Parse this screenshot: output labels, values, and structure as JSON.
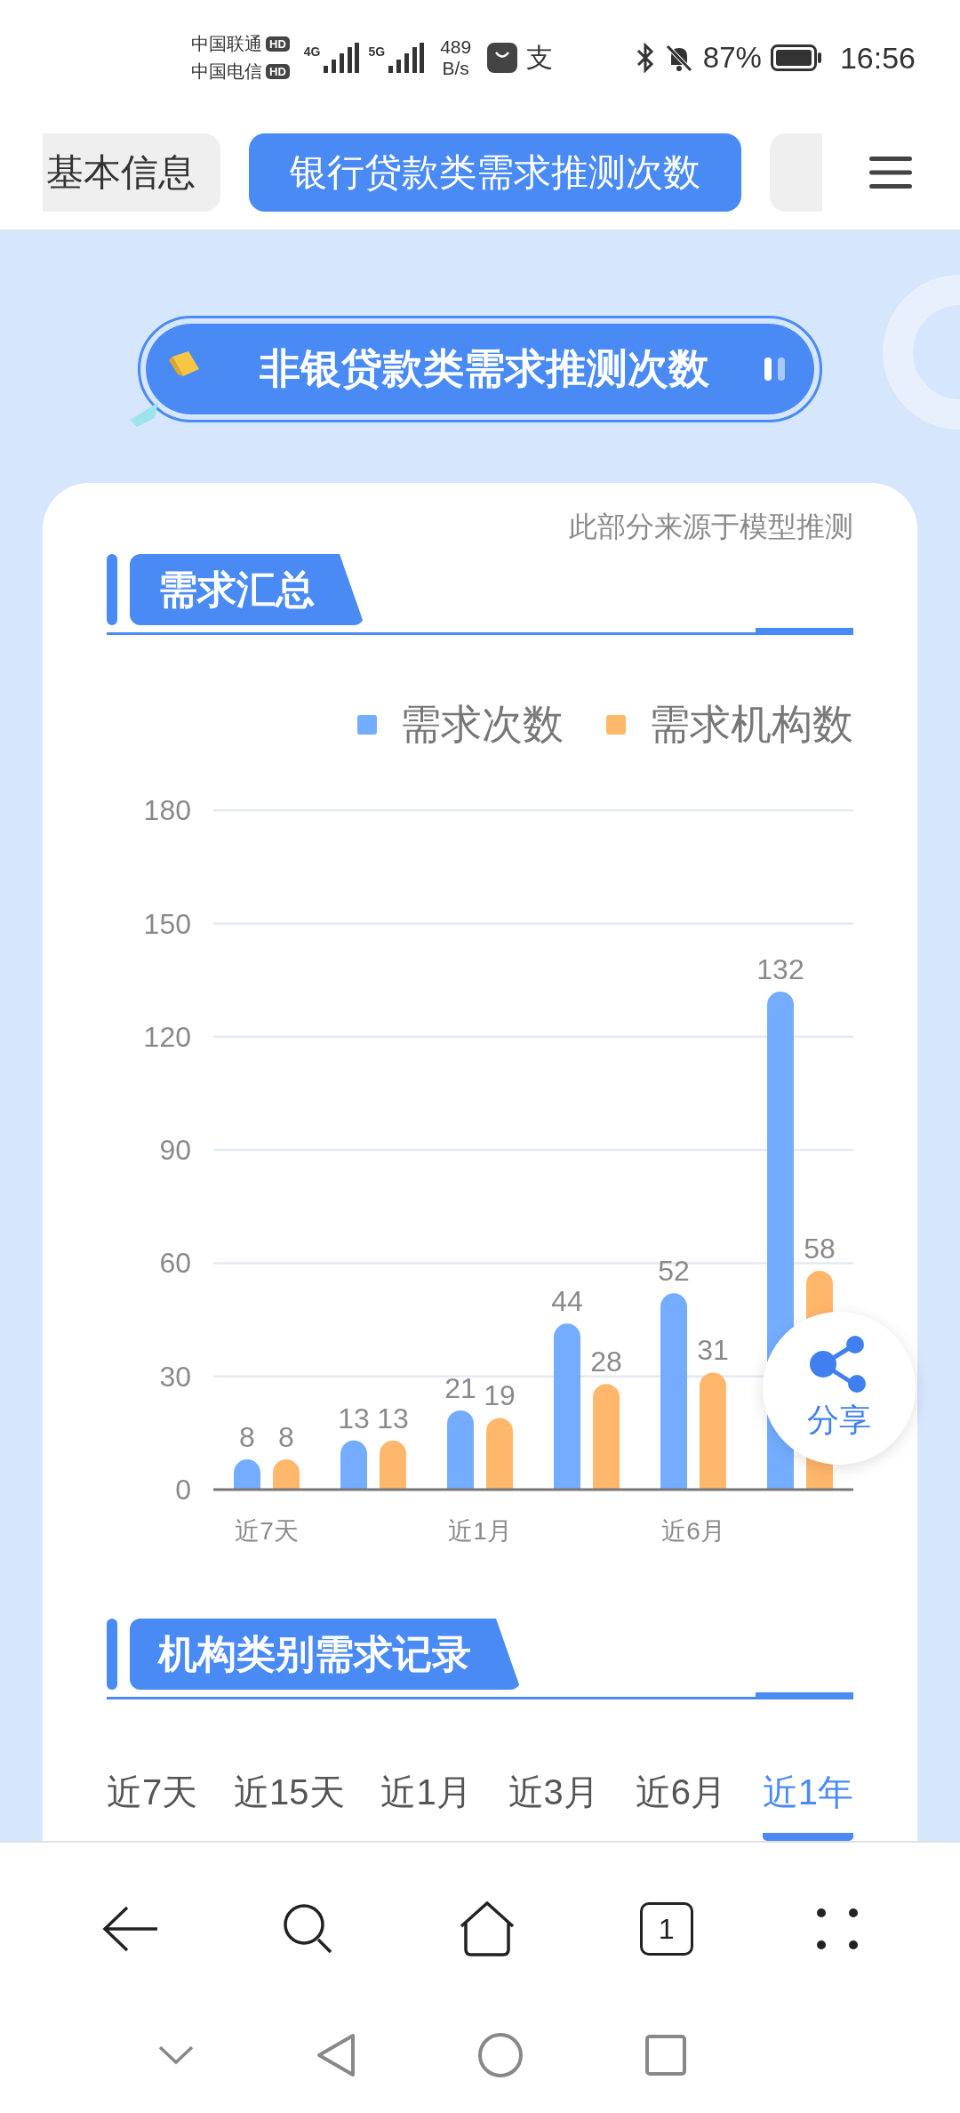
{
  "status_bar": {
    "carriers": [
      {
        "name": "中国联通",
        "badge": "HD"
      },
      {
        "name": "中国电信",
        "badge": "HD"
      }
    ],
    "networks": [
      "4G",
      "5G"
    ],
    "speed": {
      "value": "489",
      "unit": "B/s"
    },
    "app_glyph": "支",
    "battery": "87%",
    "time": "16:56"
  },
  "tabs": [
    {
      "label": "基本信息",
      "selected": false
    },
    {
      "label": "银行贷款类需求推测次数",
      "selected": true
    }
  ],
  "banner": {
    "title": "非银贷款类需求推测次数"
  },
  "card": {
    "note": "此部分来源于模型推测",
    "summary": {
      "title": "需求汇总",
      "chart_data": {
        "type": "bar",
        "categories": [
          "近7天",
          null,
          "近1月",
          null,
          "近6月",
          null
        ],
        "ylim": [
          0,
          180
        ],
        "yticks": [
          0,
          30,
          60,
          90,
          120,
          150,
          180
        ],
        "data_labels": true,
        "grid": true,
        "series": [
          {
            "name": "需求次数",
            "color": "#74adff",
            "values": [
              8,
              13,
              21,
              44,
              52,
              132
            ]
          },
          {
            "name": "需求机构数",
            "color": "#ffb76b",
            "values": [
              8,
              13,
              19,
              28,
              31,
              58
            ]
          }
        ]
      }
    },
    "records": {
      "title": "机构类别需求记录",
      "periods": [
        {
          "label": "近7天",
          "selected": false
        },
        {
          "label": "近15天",
          "selected": false
        },
        {
          "label": "近1月",
          "selected": false
        },
        {
          "label": "近3月",
          "selected": false
        },
        {
          "label": "近6月",
          "selected": false
        },
        {
          "label": "近1年",
          "selected": true
        }
      ]
    }
  },
  "share_button": {
    "label": "分享"
  },
  "bottom_nav": {
    "tab_count": "1"
  }
}
